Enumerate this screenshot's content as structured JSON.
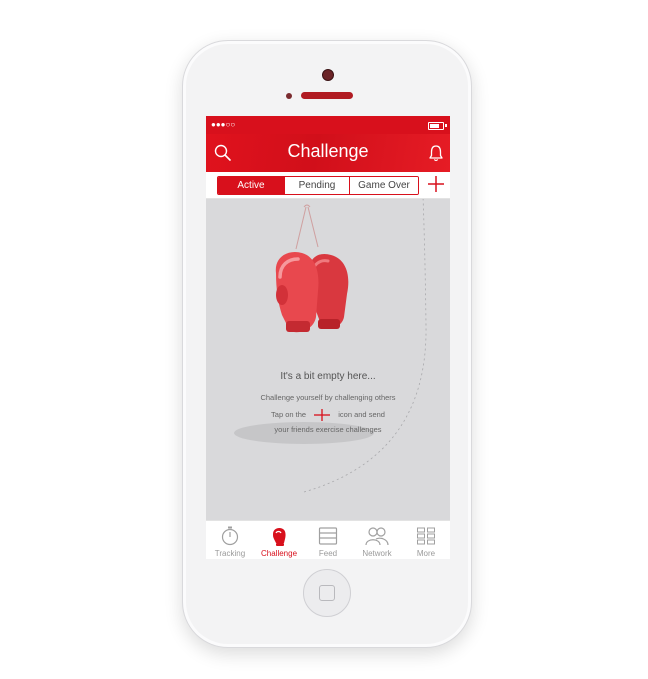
{
  "colors": {
    "accent": "#d8101c",
    "screen_bg": "#d9d9db",
    "inactive": "#9a9a9a"
  },
  "status": {
    "signal": "●●●○○"
  },
  "header": {
    "title": "Challenge",
    "left_icon": "search-icon",
    "right_icon": "bell-icon"
  },
  "segments": [
    {
      "label": "Active",
      "selected": true
    },
    {
      "label": "Pending",
      "selected": false
    },
    {
      "label": "Game Over",
      "selected": false
    }
  ],
  "add_icon": "plus-icon",
  "empty_state": {
    "illustration": "boxing-gloves",
    "title": "It's a bit empty here...",
    "line1": "Challenge yourself by challenging others",
    "line2_before": "Tap on the",
    "line2_after": "icon and send",
    "line3": "your friends exercise challenges"
  },
  "tabbar": {
    "items": [
      {
        "label": "Tracking",
        "icon": "stopwatch-icon",
        "active": false
      },
      {
        "label": "Challenge",
        "icon": "boxing-glove-icon",
        "active": true
      },
      {
        "label": "Feed",
        "icon": "feed-icon",
        "active": false
      },
      {
        "label": "Network",
        "icon": "people-icon",
        "active": false
      },
      {
        "label": "More",
        "icon": "grid-icon",
        "active": false
      }
    ]
  }
}
